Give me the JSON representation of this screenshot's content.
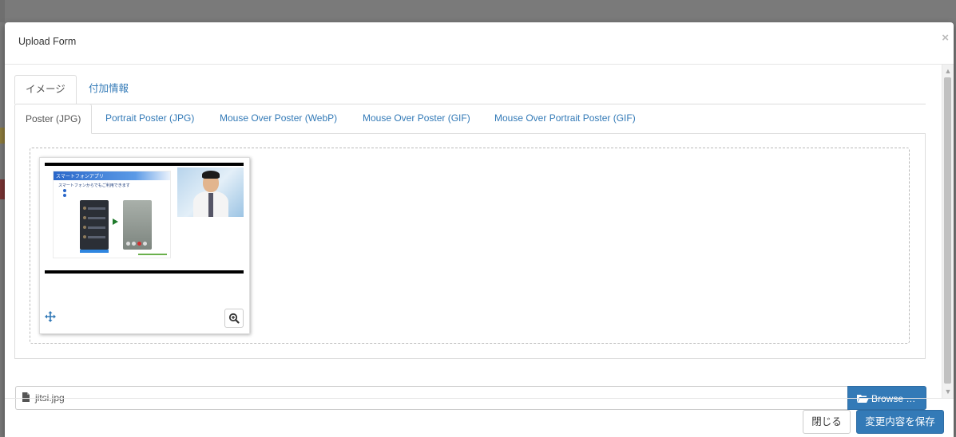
{
  "modal": {
    "title": "Upload Form",
    "close_label": "×"
  },
  "tabs_primary": [
    {
      "label": "イメージ",
      "active": true
    },
    {
      "label": "付加情報",
      "active": false
    }
  ],
  "tabs_secondary": [
    {
      "label": "Poster (JPG)",
      "active": true
    },
    {
      "label": "Portrait Poster (JPG)",
      "active": false
    },
    {
      "label": "Mouse Over Poster (WebP)",
      "active": false
    },
    {
      "label": "Mouse Over Poster (GIF)",
      "active": false
    },
    {
      "label": "Mouse Over Portrait Poster (GIF)",
      "active": false
    }
  ],
  "preview": {
    "slide_title": "スマートフォンアプリ",
    "slide_subtitle": "スマートフォンからでもご利用できます",
    "move_icon": "move-icon",
    "zoom_icon": "zoom-in-icon"
  },
  "file": {
    "name": "jitsi.jpg",
    "icon": "file-icon",
    "browse_label": "Browse …",
    "browse_icon": "folder-open-icon"
  },
  "footer": {
    "close_button": "閉じる",
    "save_button": "変更内容を保存"
  },
  "colors": {
    "primary": "#337ab7",
    "link": "#337ab7",
    "backdrop": "#7a7a7a"
  }
}
